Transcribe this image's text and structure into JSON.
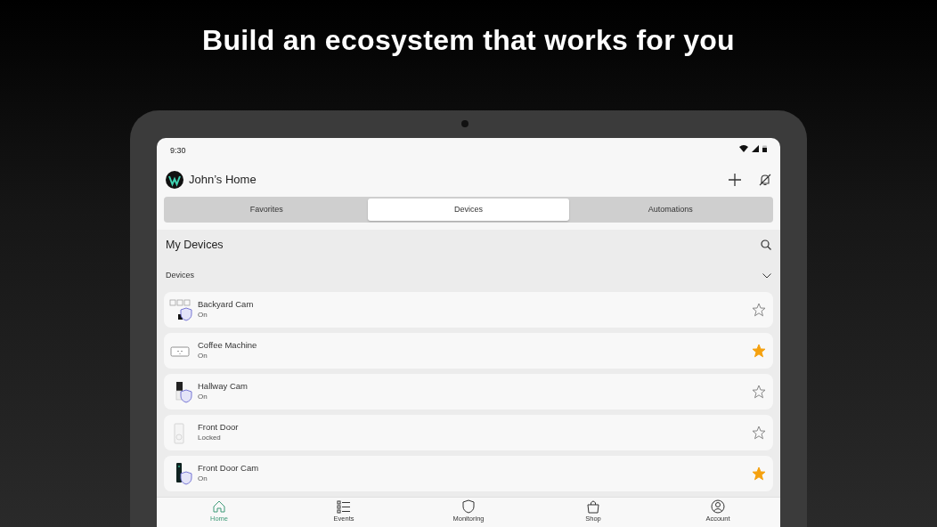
{
  "headline": "Build an ecosystem that works for you",
  "status_bar": {
    "time": "9:30"
  },
  "header": {
    "title": "John’s Home"
  },
  "tabs": [
    {
      "label": "Favorites",
      "selected": false
    },
    {
      "label": "Devices",
      "selected": true
    },
    {
      "label": "Automations",
      "selected": false
    }
  ],
  "section_title": "My Devices",
  "group": {
    "label": "Devices",
    "expanded": true
  },
  "devices": [
    {
      "name": "Backyard Cam",
      "status": "On",
      "kind": "camera-group",
      "favorite": false
    },
    {
      "name": "Coffee Machine",
      "status": "On",
      "kind": "plug",
      "favorite": true
    },
    {
      "name": "Hallway Cam",
      "status": "On",
      "kind": "camera",
      "favorite": false
    },
    {
      "name": "Front Door",
      "status": "Locked",
      "kind": "lock",
      "favorite": false
    },
    {
      "name": "Front Door Cam",
      "status": "On",
      "kind": "doorbell",
      "favorite": true
    }
  ],
  "nav": [
    {
      "label": "Home",
      "kind": "home",
      "selected": true
    },
    {
      "label": "Events",
      "kind": "list",
      "selected": false
    },
    {
      "label": "Monitoring",
      "kind": "shield",
      "selected": false
    },
    {
      "label": "Shop",
      "kind": "bag",
      "selected": false
    },
    {
      "label": "Account",
      "kind": "person",
      "selected": false
    }
  ]
}
